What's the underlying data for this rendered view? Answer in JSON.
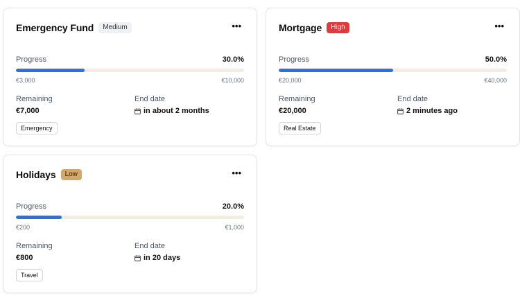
{
  "goals": [
    {
      "title": "Emergency Fund",
      "priority": "Medium",
      "priority_colors": {
        "bg": "#eef1f4",
        "fg": "#333333"
      },
      "progress_label": "Progress",
      "progress_pct": "30.0%",
      "progress_fraction": 0.3,
      "start_amount": "€3,000",
      "target_amount": "€10,000",
      "remaining_label": "Remaining",
      "remaining_value": "€7,000",
      "end_label": "End date",
      "end_value": "in about 2 months",
      "tag": "Emergency"
    },
    {
      "title": "Mortgage",
      "priority": "High",
      "priority_colors": {
        "bg": "#e5383b",
        "fg": "#ffffff"
      },
      "progress_label": "Progress",
      "progress_pct": "50.0%",
      "progress_fraction": 0.5,
      "start_amount": "€20,000",
      "target_amount": "€40,000",
      "remaining_label": "Remaining",
      "remaining_value": "€20,000",
      "end_label": "End date",
      "end_value": "2 minutes ago",
      "tag": "Real Estate"
    },
    {
      "title": "Holidays",
      "priority": "Low",
      "priority_colors": {
        "bg": "#d3a96a",
        "fg": "#2a1d0a"
      },
      "progress_label": "Progress",
      "progress_pct": "20.0%",
      "progress_fraction": 0.2,
      "start_amount": "€200",
      "target_amount": "€1,000",
      "remaining_label": "Remaining",
      "remaining_value": "€800",
      "end_label": "End date",
      "end_value": "in 20 days",
      "tag": "Travel"
    }
  ],
  "menu_icon": "ellipsis-icon",
  "calendar_icon": "calendar-icon",
  "progress_colors": {
    "fill": "#2f6fe0",
    "track": "#f3ece0"
  }
}
